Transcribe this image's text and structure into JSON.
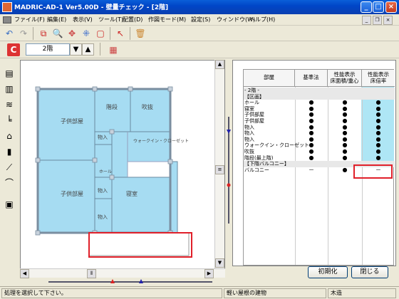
{
  "window": {
    "title": "MADRIC-AD-1 Ver5.00D - 壁量チェック - [2階]"
  },
  "menu": [
    "ファイル(F)",
    "編集(E)",
    "表示(V)",
    "ツール(T)",
    "配置(D)",
    "作図モード(M)",
    "設定(S)",
    "ウィンドウ(W)",
    "ヘルプ(H)"
  ],
  "toolbar2": {
    "floor": "2階"
  },
  "plan": {
    "rooms": {
      "kids1": "子供部屋",
      "kids2": "子供部屋",
      "stairs": "階段",
      "void": "吹抜",
      "closet1": "物入",
      "closet2": "物入",
      "closet3": "物入",
      "wic": "ウォークイン・クローゼット",
      "hall": "ホール",
      "bedroom": "寝室"
    }
  },
  "table": {
    "headers": [
      "部屋",
      "基準法",
      "性能表示\n床面積/重心",
      "性能表示\n床倍率"
    ],
    "rows": [
      {
        "label": "- 2階 -",
        "type": "section",
        "c1": "",
        "c2": "",
        "c3": ""
      },
      {
        "label": "【区画】",
        "type": "section",
        "c1": "",
        "c2": "",
        "c3": ""
      },
      {
        "label": "ホール",
        "c1": "●",
        "c2": "●",
        "c3": "●"
      },
      {
        "label": "寝室",
        "c1": "●",
        "c2": "●",
        "c3": "●"
      },
      {
        "label": "子供部屋",
        "c1": "●",
        "c2": "●",
        "c3": "●"
      },
      {
        "label": "子供部屋",
        "c1": "●",
        "c2": "●",
        "c3": "●"
      },
      {
        "label": "物入",
        "c1": "●",
        "c2": "●",
        "c3": "●"
      },
      {
        "label": "物入",
        "c1": "●",
        "c2": "●",
        "c3": "●"
      },
      {
        "label": "物入",
        "c1": "●",
        "c2": "●",
        "c3": "●"
      },
      {
        "label": "ウォークイン・クローゼット",
        "c1": "●",
        "c2": "●",
        "c3": "●"
      },
      {
        "label": "吹抜",
        "c1": "●",
        "c2": "●",
        "c3": "●"
      },
      {
        "label": "階段(最上階)",
        "c1": "●",
        "c2": "●",
        "c3": "●"
      },
      {
        "label": "【下階バルコニー】",
        "type": "section",
        "c1": "",
        "c2": "",
        "c3": ""
      },
      {
        "label": "バルコニー",
        "c1": "－",
        "c2": "●",
        "c3": "－"
      }
    ]
  },
  "buttons": {
    "init": "初期化",
    "close": "閉じる"
  },
  "status": {
    "message": "処理を選択して下さい。",
    "building": "軽い屋根の建物",
    "structure": "木造"
  },
  "colors": {
    "room_fill": "#a6dcf2",
    "highlight": "#e0202a",
    "accent_blue": "#aee6f5"
  }
}
